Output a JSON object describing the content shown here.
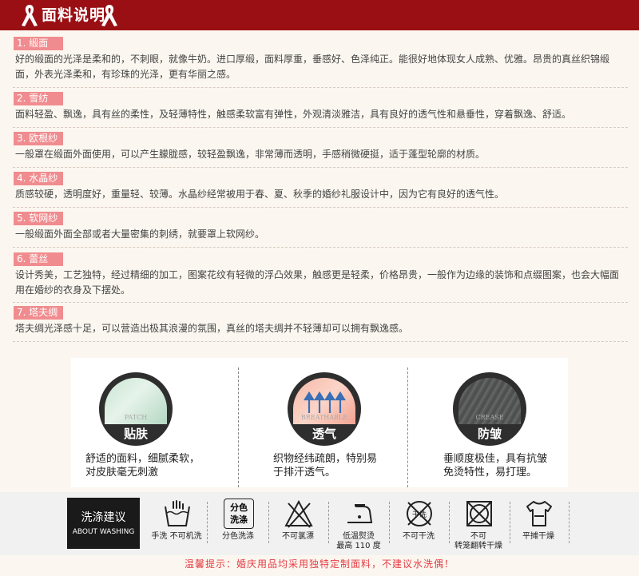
{
  "header": {
    "title": "面料说明"
  },
  "sections": [
    {
      "tag": "1. 缎面",
      "text": "好的缎面的光泽是柔和的，不刺眼，就像牛奶。进口厚缎，面料厚重，垂感好、色泽纯正。能很好地体现女人成熟、优雅。昂贵的真丝织锦缎面，外表光泽柔和，有珍珠的光泽，更有华丽之感。"
    },
    {
      "tag": "2. 雪纺",
      "text": "面料轻盈、飘逸，具有丝的柔性，及轻薄特性，触感柔软富有弹性，外观清淡雅洁，具有良好的透气性和悬垂性，穿着飘逸、舒适。"
    },
    {
      "tag": "3. 欧根纱",
      "text": "一般罩在缎面外面使用，可以产生朦胧感，较轻盈飘逸，非常薄而透明，手感稍微硬挺，适于蓬型轮廓的材质。"
    },
    {
      "tag": "4. 水晶纱",
      "text": "质感较硬，透明度好，重量轻、较薄。水晶纱经常被用于春、夏、秋季的婚纱礼服设计中，因为它有良好的透气性。"
    },
    {
      "tag": "5. 软网纱",
      "text": "一般缎面外面全部或者大量密集的刺绣，就要罩上软网纱。"
    },
    {
      "tag": "6. 蕾丝",
      "text": "设计秀美，工艺独特，经过精细的加工，图案花纹有轻微的浮凸效果，触感更是轻柔，价格昂贵，一般作为边缘的装饰和点缀图案，也会大幅面用在婚纱的衣身及下摆处。"
    },
    {
      "tag": "7. 塔夫绸",
      "text": "塔夫绸光泽感十足，可以营造出极其浪漫的氛围，真丝的塔夫绸并不轻薄却可以拥有飘逸感。"
    }
  ],
  "features": [
    {
      "en": "PATCH",
      "cn": "贴肤",
      "line1": "舒适的面料，细腻柔软，",
      "line2": "对皮肤毫无刺激"
    },
    {
      "en": "BREATHABLE",
      "cn": "透气",
      "line1": "织物经纬疏朗，特别易",
      "line2": "于排汗透气。"
    },
    {
      "en": "CREASE",
      "cn": "防皱",
      "line1": "垂顺度极佳，具有抗皱",
      "line2": "免烫特性，易打理。"
    }
  ],
  "washing": {
    "title_cn": "洗涤建议",
    "title_en": "ABOUT WASHING",
    "items": [
      {
        "icon": "hand-wash-icon",
        "label": "手洗 不可机洗"
      },
      {
        "icon": "separate-wash-icon",
        "icon_text1": "分色",
        "icon_text2": "洗涤",
        "label": "分色洗涤"
      },
      {
        "icon": "no-bleach-icon",
        "label": "不可氯漂"
      },
      {
        "icon": "low-iron-icon",
        "label": "低温熨烫",
        "label2": "最高 110 度"
      },
      {
        "icon": "no-dry-clean-icon",
        "icon_text1": "干洗",
        "label": "不可干洗"
      },
      {
        "icon": "no-tumble-dry-icon",
        "label": "不可",
        "label2": "转笼翻转干燥"
      },
      {
        "icon": "flat-dry-icon",
        "label": "平摊干燥"
      }
    ]
  },
  "tip": "温馨提示：婚庆用品均采用独特定制面料，不建议水洗偶！",
  "colors": {
    "header": "#9a0f14",
    "tag": "#f08c8f",
    "tip": "#e43c44"
  }
}
